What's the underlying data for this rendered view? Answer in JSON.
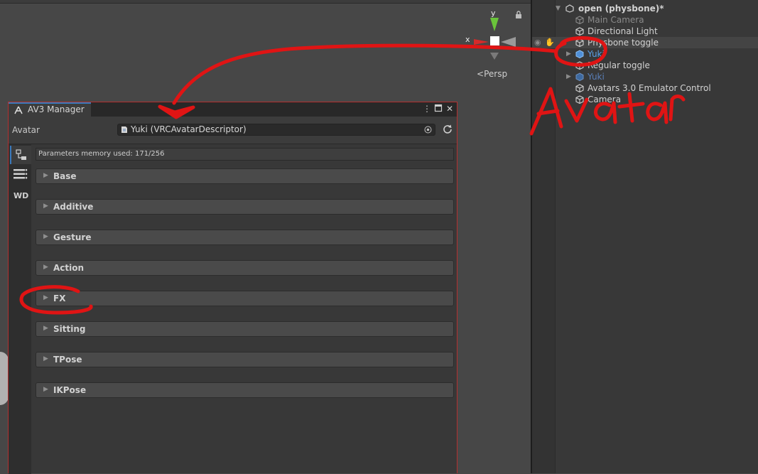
{
  "scene": {
    "axis_y": "y",
    "axis_x": "x",
    "persp_label": "Persp",
    "lock_icon": "lock-icon"
  },
  "hierarchy": {
    "root_label": "open (physbone)*",
    "items": [
      {
        "label": "Main Camera"
      },
      {
        "label": "Directional Light"
      },
      {
        "label": "Physbone toggle"
      },
      {
        "label": "Yuki"
      },
      {
        "label": "Regular toggle"
      },
      {
        "label": "Yuki"
      },
      {
        "label": "Avatars 3.0 Emulator Control"
      },
      {
        "label": "Camera"
      }
    ]
  },
  "av3": {
    "tab_label": "AV3 Manager",
    "avatar_label": "Avatar",
    "avatar_value": "Yuki (VRCAvatarDescriptor)",
    "side_tab_wd": "WD",
    "memory_text": "Parameters memory used: 171/256",
    "layers": [
      {
        "name": "Base"
      },
      {
        "name": "Additive"
      },
      {
        "name": "Gesture"
      },
      {
        "name": "Action"
      },
      {
        "name": "FX"
      },
      {
        "name": "Sitting"
      },
      {
        "name": "TPose"
      },
      {
        "name": "IKPose"
      }
    ]
  },
  "annotation": {
    "handwritten_text": "Avatar",
    "color": "#e01414"
  },
  "colors": {
    "accent": "#3a79bb",
    "selected_text": "#5aa0e8",
    "window_border": "#b32f2f"
  }
}
